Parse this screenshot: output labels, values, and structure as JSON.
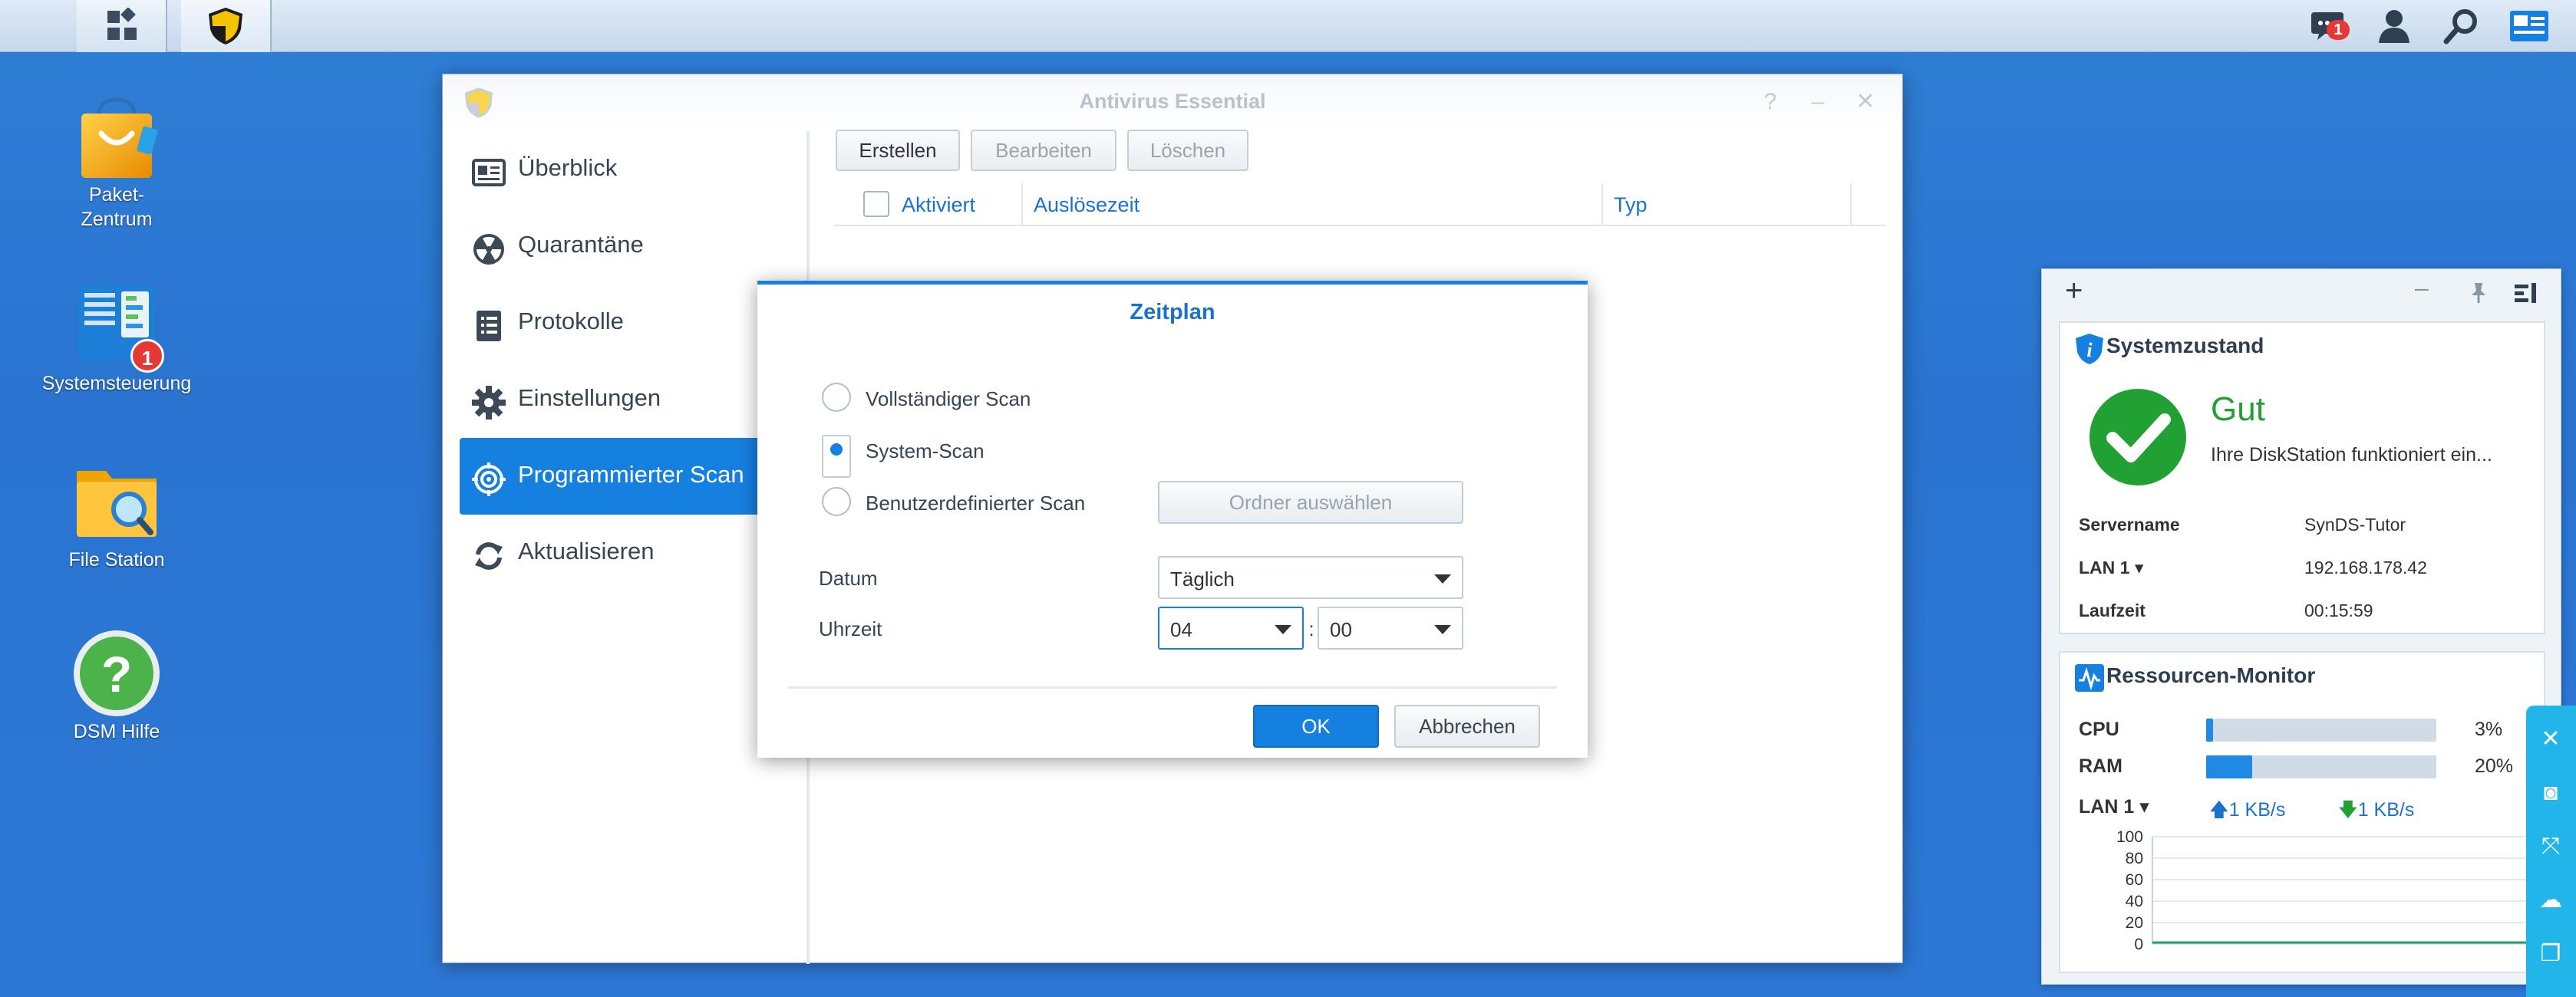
{
  "taskbar": {
    "notifications_count": "1"
  },
  "desktop": {
    "icons": [
      {
        "label1": "Paket-",
        "label2": "Zentrum"
      },
      {
        "label1": "Systemsteuerung",
        "badge": "1"
      },
      {
        "label1": "File Station"
      },
      {
        "label1": "DSM Hilfe"
      }
    ]
  },
  "window": {
    "title": "Antivirus Essential",
    "sidebar": [
      {
        "label": "Überblick",
        "icon": "overview-icon"
      },
      {
        "label": "Quarantäne",
        "icon": "radiation-icon"
      },
      {
        "label": "Protokolle",
        "icon": "log-icon"
      },
      {
        "label": "Einstellungen",
        "icon": "gear-icon"
      },
      {
        "label": "Programmierter Scan",
        "icon": "target-icon",
        "active": true
      },
      {
        "label": "Aktualisieren",
        "icon": "refresh-icon"
      }
    ],
    "toolbar": {
      "create": "Erstellen",
      "edit": "Bearbeiten",
      "delete": "Löschen"
    },
    "columns": {
      "enabled": "Aktiviert",
      "trigger_time": "Auslösezeit",
      "type": "Typ"
    }
  },
  "dialog": {
    "title": "Zeitplan",
    "options": {
      "full": "Vollständiger Scan",
      "system": "System-Scan",
      "custom": "Benutzerdefinierter Scan"
    },
    "selected_option": "System-Scan",
    "choose_folder": "Ordner auswählen",
    "date_label": "Datum",
    "date_value": "Täglich",
    "time_label": "Uhrzeit",
    "hour": "04",
    "colon": ":",
    "minute": "00",
    "ok": "OK",
    "cancel": "Abbrechen"
  },
  "widgets": {
    "system": {
      "title": "Systemzustand",
      "status": "Gut",
      "message": "Ihre DiskStation funktioniert ein...",
      "server_label": "Servername",
      "server_value": "SynDS-Tutor",
      "lan_label": "LAN 1",
      "lan_value": "192.168.178.42",
      "uptime_label": "Laufzeit",
      "uptime_value": "00:15:59"
    },
    "monitor": {
      "title": "Ressourcen-Monitor",
      "cpu_label": "CPU",
      "cpu_value": "3%",
      "cpu_fraction": 0.03,
      "ram_label": "RAM",
      "ram_value": "20%",
      "ram_fraction": 0.2,
      "lan_label": "LAN 1",
      "up": "1 KB/s",
      "down": "1 KB/s",
      "y_ticks": [
        "100",
        "80",
        "60",
        "40",
        "20",
        "0"
      ]
    }
  },
  "colors": {
    "accent": "#1680e0",
    "ok_green": "#21a033",
    "desktop_blue": "#2d78d6"
  }
}
